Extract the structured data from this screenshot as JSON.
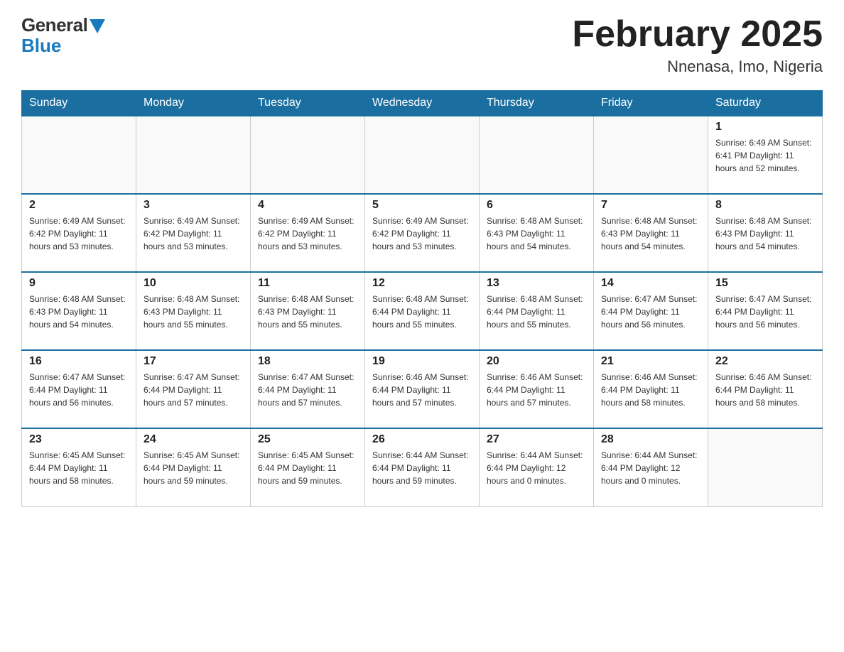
{
  "header": {
    "logo_general": "General",
    "logo_blue": "Blue",
    "title": "February 2025",
    "subtitle": "Nnenasa, Imo, Nigeria"
  },
  "days_of_week": [
    "Sunday",
    "Monday",
    "Tuesday",
    "Wednesday",
    "Thursday",
    "Friday",
    "Saturday"
  ],
  "weeks": [
    {
      "cells": [
        {
          "day": "",
          "info": ""
        },
        {
          "day": "",
          "info": ""
        },
        {
          "day": "",
          "info": ""
        },
        {
          "day": "",
          "info": ""
        },
        {
          "day": "",
          "info": ""
        },
        {
          "day": "",
          "info": ""
        },
        {
          "day": "1",
          "info": "Sunrise: 6:49 AM\nSunset: 6:41 PM\nDaylight: 11 hours\nand 52 minutes."
        }
      ]
    },
    {
      "cells": [
        {
          "day": "2",
          "info": "Sunrise: 6:49 AM\nSunset: 6:42 PM\nDaylight: 11 hours\nand 53 minutes."
        },
        {
          "day": "3",
          "info": "Sunrise: 6:49 AM\nSunset: 6:42 PM\nDaylight: 11 hours\nand 53 minutes."
        },
        {
          "day": "4",
          "info": "Sunrise: 6:49 AM\nSunset: 6:42 PM\nDaylight: 11 hours\nand 53 minutes."
        },
        {
          "day": "5",
          "info": "Sunrise: 6:49 AM\nSunset: 6:42 PM\nDaylight: 11 hours\nand 53 minutes."
        },
        {
          "day": "6",
          "info": "Sunrise: 6:48 AM\nSunset: 6:43 PM\nDaylight: 11 hours\nand 54 minutes."
        },
        {
          "day": "7",
          "info": "Sunrise: 6:48 AM\nSunset: 6:43 PM\nDaylight: 11 hours\nand 54 minutes."
        },
        {
          "day": "8",
          "info": "Sunrise: 6:48 AM\nSunset: 6:43 PM\nDaylight: 11 hours\nand 54 minutes."
        }
      ]
    },
    {
      "cells": [
        {
          "day": "9",
          "info": "Sunrise: 6:48 AM\nSunset: 6:43 PM\nDaylight: 11 hours\nand 54 minutes."
        },
        {
          "day": "10",
          "info": "Sunrise: 6:48 AM\nSunset: 6:43 PM\nDaylight: 11 hours\nand 55 minutes."
        },
        {
          "day": "11",
          "info": "Sunrise: 6:48 AM\nSunset: 6:43 PM\nDaylight: 11 hours\nand 55 minutes."
        },
        {
          "day": "12",
          "info": "Sunrise: 6:48 AM\nSunset: 6:44 PM\nDaylight: 11 hours\nand 55 minutes."
        },
        {
          "day": "13",
          "info": "Sunrise: 6:48 AM\nSunset: 6:44 PM\nDaylight: 11 hours\nand 55 minutes."
        },
        {
          "day": "14",
          "info": "Sunrise: 6:47 AM\nSunset: 6:44 PM\nDaylight: 11 hours\nand 56 minutes."
        },
        {
          "day": "15",
          "info": "Sunrise: 6:47 AM\nSunset: 6:44 PM\nDaylight: 11 hours\nand 56 minutes."
        }
      ]
    },
    {
      "cells": [
        {
          "day": "16",
          "info": "Sunrise: 6:47 AM\nSunset: 6:44 PM\nDaylight: 11 hours\nand 56 minutes."
        },
        {
          "day": "17",
          "info": "Sunrise: 6:47 AM\nSunset: 6:44 PM\nDaylight: 11 hours\nand 57 minutes."
        },
        {
          "day": "18",
          "info": "Sunrise: 6:47 AM\nSunset: 6:44 PM\nDaylight: 11 hours\nand 57 minutes."
        },
        {
          "day": "19",
          "info": "Sunrise: 6:46 AM\nSunset: 6:44 PM\nDaylight: 11 hours\nand 57 minutes."
        },
        {
          "day": "20",
          "info": "Sunrise: 6:46 AM\nSunset: 6:44 PM\nDaylight: 11 hours\nand 57 minutes."
        },
        {
          "day": "21",
          "info": "Sunrise: 6:46 AM\nSunset: 6:44 PM\nDaylight: 11 hours\nand 58 minutes."
        },
        {
          "day": "22",
          "info": "Sunrise: 6:46 AM\nSunset: 6:44 PM\nDaylight: 11 hours\nand 58 minutes."
        }
      ]
    },
    {
      "cells": [
        {
          "day": "23",
          "info": "Sunrise: 6:45 AM\nSunset: 6:44 PM\nDaylight: 11 hours\nand 58 minutes."
        },
        {
          "day": "24",
          "info": "Sunrise: 6:45 AM\nSunset: 6:44 PM\nDaylight: 11 hours\nand 59 minutes."
        },
        {
          "day": "25",
          "info": "Sunrise: 6:45 AM\nSunset: 6:44 PM\nDaylight: 11 hours\nand 59 minutes."
        },
        {
          "day": "26",
          "info": "Sunrise: 6:44 AM\nSunset: 6:44 PM\nDaylight: 11 hours\nand 59 minutes."
        },
        {
          "day": "27",
          "info": "Sunrise: 6:44 AM\nSunset: 6:44 PM\nDaylight: 12 hours\nand 0 minutes."
        },
        {
          "day": "28",
          "info": "Sunrise: 6:44 AM\nSunset: 6:44 PM\nDaylight: 12 hours\nand 0 minutes."
        },
        {
          "day": "",
          "info": ""
        }
      ]
    }
  ]
}
